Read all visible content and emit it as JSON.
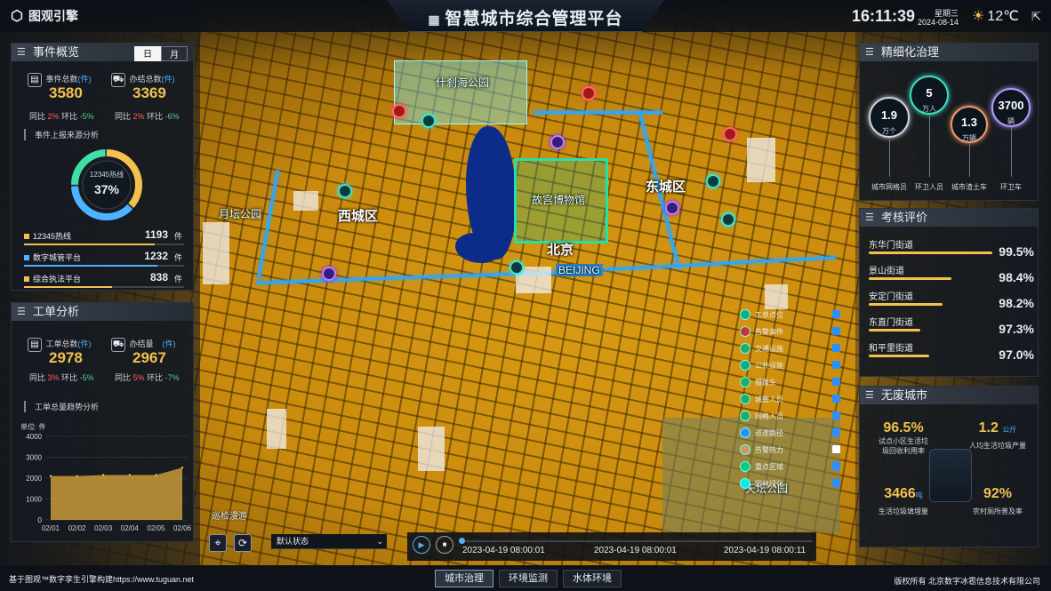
{
  "app": {
    "logo_text": "图观引擎",
    "title": "智慧城市综合管理平台"
  },
  "header": {
    "time": "16:11:39",
    "weekday": "星期三",
    "date": "2024-08-14",
    "temperature": "12℃",
    "weather_icon": "sun-icon"
  },
  "events": {
    "title": "事件概览",
    "tabs": [
      "日",
      "月"
    ],
    "active_tab": "日",
    "total_label": "事件总数",
    "total_unit": "(件)",
    "total_value": "3580",
    "done_label": "办结总数",
    "done_unit": "(件)",
    "done_value": "3369",
    "total_yoy": "同比",
    "total_yoy_val": "2%",
    "total_mom": "环比",
    "total_mom_val": "-5%",
    "done_yoy": "同比",
    "done_yoy_val": "2%",
    "done_mom": "环比",
    "done_mom_val": "-6%",
    "source_title": "事件上报来源分析",
    "donut_label": "12345热线",
    "donut_percent": "37%",
    "sources": [
      {
        "name": "12345热线",
        "value": "1193",
        "unit": "件",
        "color": "#f2c14e",
        "share": 0.37
      },
      {
        "name": "数字城管平台",
        "value": "1232",
        "unit": "件",
        "color": "#4db2ff",
        "share": 0.38
      },
      {
        "name": "综合执法平台",
        "value": "838",
        "unit": "件",
        "color": "#f2c14e",
        "share": 0.25
      }
    ]
  },
  "workorders": {
    "title": "工单分析",
    "total_label": "工单总数",
    "total_unit": "(件)",
    "total_value": "2978",
    "done_label": "办结量",
    "done_unit": "(件)",
    "done_value": "2967",
    "total_yoy": "同比",
    "total_yoy_val": "3%",
    "total_mom": "环比",
    "total_mom_val": "-5%",
    "done_yoy": "同比",
    "done_yoy_val": "5%",
    "done_mom": "环比",
    "done_mom_val": "-7%",
    "trend_title": "工单总量趋势分析"
  },
  "chart_data": {
    "type": "area",
    "ylabel": "单位: 件",
    "ylim": [
      0,
      4000
    ],
    "yticks": [
      "4000",
      "3000",
      "2000",
      "1000",
      "0"
    ],
    "categories": [
      "02/01",
      "02/02",
      "02/03",
      "02/04",
      "02/05",
      "02/06"
    ],
    "values": [
      2100,
      2100,
      2150,
      2150,
      2150,
      2500
    ],
    "grid": true
  },
  "governance": {
    "title": "精细化治理",
    "items": [
      {
        "value": "1.9",
        "unit": "万个",
        "label": "城市网格员",
        "color": "#cfd6df"
      },
      {
        "value": "5",
        "unit": "万人",
        "label": "环卫人员",
        "color": "#3fe0c0"
      },
      {
        "value": "1.3",
        "unit": "万辆",
        "label": "城市渣土车",
        "color": "#f29a6a"
      },
      {
        "value": "3700",
        "unit": "辆",
        "label": "环卫车",
        "color": "#b79cff"
      }
    ]
  },
  "assessment": {
    "title": "考核评价",
    "items": [
      {
        "name": "东华门街道",
        "value": "99.5%",
        "pct": 0.995
      },
      {
        "name": "景山街道",
        "value": "98.4%",
        "pct": 0.984
      },
      {
        "name": "安定门街道",
        "value": "98.2%",
        "pct": 0.982
      },
      {
        "name": "东直门街道",
        "value": "97.3%",
        "pct": 0.973
      },
      {
        "name": "和平里街道",
        "value": "97.0%",
        "pct": 0.97
      }
    ]
  },
  "zerowaste": {
    "title": "无废城市",
    "a_value": "96.5%",
    "a_label1": "试点小区生活垃",
    "a_label2": "圾回收利用率",
    "b_value": "1.2",
    "b_unit": "公斤",
    "b_label": "人均生活垃圾产量",
    "c_value": "3466",
    "c_unit": "吨",
    "c_label": "生活垃圾填埋量",
    "d_value": "92%",
    "d_label": "农村厕所普及率"
  },
  "map": {
    "labels": {
      "shicha": "什刹海公园",
      "xicheng": "西城区",
      "dongcheng": "东城区",
      "gugong": "故宫博物馆",
      "yuetan": "月坛公园",
      "beijing": "北京",
      "beijing_en": "BEIJING",
      "tiantan": "天坛公园"
    },
    "layers": [
      {
        "name": "工单点位",
        "icon": "workorder-icon"
      },
      {
        "name": "告警事件",
        "icon": "alarm-icon"
      },
      {
        "name": "交通设施",
        "icon": "traffic-icon"
      },
      {
        "name": "公共设施",
        "icon": "facility-icon"
      },
      {
        "name": "摄像头",
        "icon": "camera-icon"
      },
      {
        "name": "城管人员",
        "icon": "inspector-icon"
      },
      {
        "name": "网格人员",
        "icon": "grid-staff-icon"
      },
      {
        "name": "巡逻路径",
        "icon": "patrol-path-icon"
      },
      {
        "name": "告警热力",
        "icon": "heat-icon"
      },
      {
        "name": "重点区域",
        "icon": "key-area-icon"
      },
      {
        "name": "园林绿化",
        "icon": "greenery-icon"
      }
    ],
    "patrol_label": "巡检漫游",
    "state_select": "默认状态",
    "timeline": [
      "2023-04-19 08:00:01",
      "2023-04-19 08:00:01",
      "2023-04-19 08:00:11"
    ]
  },
  "footer": {
    "left": "基于图观™数字孪生引擎构建https://www.tuguan.net",
    "right": "版权所有 北京数字冰雹信息技术有限公司",
    "tabs": [
      "城市治理",
      "环境监测",
      "水体环境"
    ],
    "active_tab": "城市治理"
  }
}
